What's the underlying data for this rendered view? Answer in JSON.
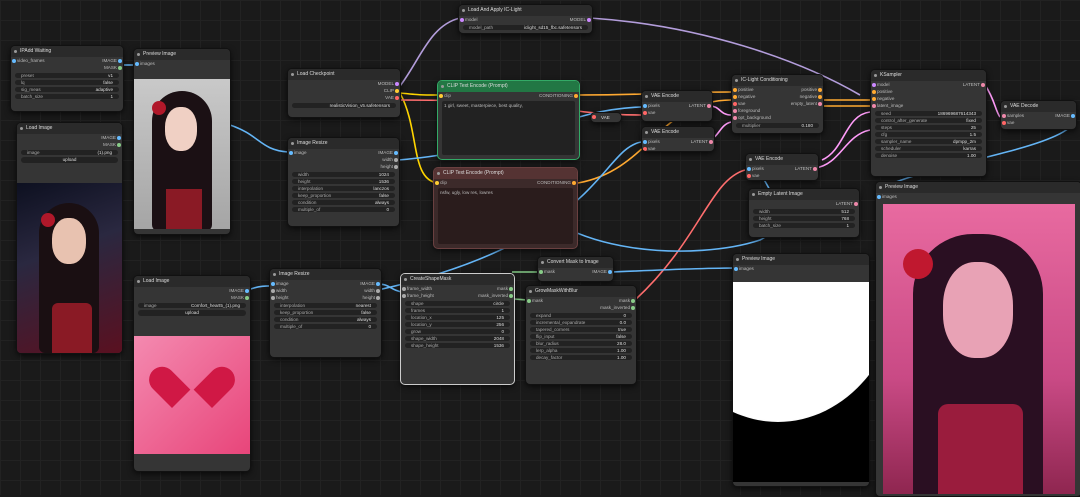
{
  "nodes": {
    "ipa": {
      "title": "IPAdd Waiting",
      "inputs": [
        "video_frames"
      ],
      "outputs": [
        "IMAGE",
        "MASK"
      ],
      "widgets": [
        {
          "k": "preset",
          "v": "v1"
        },
        {
          "k": "lq",
          "v": "false"
        },
        {
          "k": "sig_meas",
          "v": "adaptive"
        },
        {
          "k": "batch_size",
          "v": "1"
        }
      ]
    },
    "li1": {
      "title": "Load Image",
      "outputs": [
        "IMAGE",
        "MASK"
      ],
      "widgets": [
        {
          "k": "image",
          "v": "(1).png"
        }
      ],
      "button": "upload"
    },
    "pv1": {
      "title": "Preview Image",
      "inputs": [
        "images"
      ]
    },
    "lckpt": {
      "title": "Load Checkpoint",
      "outputs": [
        "MODEL",
        "CLIP",
        "VAE"
      ],
      "widgets": [
        {
          "k": "ckpt_name",
          "v": "realisticVision_v5.safetensors"
        }
      ]
    },
    "lapply": {
      "title": "Load And Apply IC-Light",
      "inputs": [
        "model"
      ],
      "outputs": [
        "MODEL"
      ],
      "widgets": [
        {
          "k": "model_path",
          "v": "iclight_sd15_fbc.safetensors"
        }
      ]
    },
    "clip1": {
      "title": "CLIP Text Encode (Prompt)",
      "inputs": [
        "clip"
      ],
      "outputs": [
        "CONDITIONING"
      ],
      "text": "1 girl, sweet, masterpiece, best quality,"
    },
    "clip2": {
      "title": "CLIP Text Encode (Prompt)",
      "inputs": [
        "clip"
      ],
      "outputs": [
        "CONDITIONING"
      ],
      "text": "nsfw, ugly, low res, lowres"
    },
    "resize1": {
      "title": "Image Resize",
      "inputs": [
        "image"
      ],
      "outputs": [
        "IMAGE",
        "width",
        "height"
      ],
      "widgets": [
        {
          "k": "width",
          "v": "1024"
        },
        {
          "k": "height",
          "v": "1536"
        },
        {
          "k": "interpolation",
          "v": "lanczos"
        },
        {
          "k": "keep_proportion",
          "v": "false"
        },
        {
          "k": "condition",
          "v": "always"
        },
        {
          "k": "multiple_of",
          "v": "0"
        }
      ]
    },
    "vae1": {
      "title": "VAE Encode",
      "inputs": [
        "pixels",
        "vae"
      ],
      "outputs": [
        "LATENT"
      ]
    },
    "vae2": {
      "title": "VAE Encode",
      "inputs": [
        "pixels",
        "vae"
      ],
      "outputs": [
        "LATENT"
      ]
    },
    "vaeneg": {
      "title": "VAE",
      "outputs": []
    },
    "iclc": {
      "title": "IC-Light Conditioning",
      "inputs": [
        "positive",
        "negative",
        "vae",
        "foreground",
        "opt_background"
      ],
      "outputs": [
        "positive",
        "negative",
        "empty_latent"
      ],
      "widgets": [
        {
          "k": "multiplier",
          "v": "0.180"
        }
      ]
    },
    "ksamp": {
      "title": "KSampler",
      "inputs": [
        "model",
        "positive",
        "negative",
        "latent_image"
      ],
      "outputs": [
        "LATENT"
      ],
      "widgets": [
        {
          "k": "seed",
          "v": "186969687614343"
        },
        {
          "k": "control_after_generate",
          "v": "fixed"
        },
        {
          "k": "steps",
          "v": "25"
        },
        {
          "k": "cfg",
          "v": "1.5"
        },
        {
          "k": "sampler_name",
          "v": "dpmpp_2m"
        },
        {
          "k": "scheduler",
          "v": "karras"
        },
        {
          "k": "denoise",
          "v": "1.00"
        }
      ]
    },
    "vaedec": {
      "title": "VAE Decode",
      "inputs": [
        "samples",
        "vae"
      ],
      "outputs": [
        "IMAGE"
      ]
    },
    "vae3": {
      "title": "VAE Encode",
      "inputs": [
        "pixels",
        "vae"
      ],
      "outputs": [
        "LATENT"
      ]
    },
    "empty": {
      "title": "Empty Latent Image",
      "outputs": [
        "LATENT"
      ],
      "widgets": [
        {
          "k": "width",
          "v": "512"
        },
        {
          "k": "height",
          "v": "768"
        },
        {
          "k": "batch_size",
          "v": "1"
        }
      ]
    },
    "pv2": {
      "title": "Preview Image",
      "inputs": [
        "images"
      ]
    },
    "li2": {
      "title": "Load Image",
      "outputs": [
        "IMAGE",
        "MASK"
      ],
      "widgets": [
        {
          "k": "image",
          "v": "Comfort_heart5_(1).png"
        }
      ],
      "button": "upload"
    },
    "resize2": {
      "title": "Image Resize",
      "inputs": [
        "image",
        "width",
        "height"
      ],
      "outputs": [
        "IMAGE",
        "width",
        "height"
      ],
      "widgets": [
        {
          "k": "interpolation",
          "v": "nearest"
        },
        {
          "k": "keep_proportion",
          "v": "false"
        },
        {
          "k": "condition",
          "v": "always"
        },
        {
          "k": "multiple_of",
          "v": "0"
        }
      ]
    },
    "shape": {
      "title": "CreateShapeMask",
      "inputs": [
        "frame_width",
        "frame_height"
      ],
      "outputs": [
        "mask",
        "mask_inverted"
      ],
      "widgets": [
        {
          "k": "shape",
          "v": "circle"
        },
        {
          "k": "frames",
          "v": "1"
        },
        {
          "k": "location_x",
          "v": "125"
        },
        {
          "k": "location_y",
          "v": "256"
        },
        {
          "k": "grow",
          "v": "0"
        },
        {
          "k": "shape_width",
          "v": "2048"
        },
        {
          "k": "shape_height",
          "v": "1536"
        }
      ]
    },
    "cmi": {
      "title": "Convert Mask to Image",
      "inputs": [
        "mask"
      ],
      "outputs": [
        "IMAGE"
      ]
    },
    "grow": {
      "title": "GrowMaskWithBlur",
      "inputs": [
        "mask"
      ],
      "outputs": [
        "mask",
        "mask_inverted"
      ],
      "widgets": [
        {
          "k": "expand",
          "v": "0"
        },
        {
          "k": "incremental_expandrate",
          "v": "0.0"
        },
        {
          "k": "tapered_corners",
          "v": "true"
        },
        {
          "k": "flip_input",
          "v": "false"
        },
        {
          "k": "blur_radius",
          "v": "28.0"
        },
        {
          "k": "lerp_alpha",
          "v": "1.00"
        },
        {
          "k": "decay_factor",
          "v": "1.00"
        }
      ]
    },
    "pv3": {
      "title": "Preview Image",
      "inputs": [
        "images"
      ]
    },
    "pv4": {
      "title": "Preview Image",
      "inputs": [
        "images"
      ]
    }
  },
  "colors": {
    "clip": "#ffd500",
    "model": "#b39ddb",
    "vae": "#ff6e6e",
    "image": "#64b5f6",
    "latent": "#ff9cf9",
    "cond": "#ffa931",
    "mask": "#81c784"
  }
}
